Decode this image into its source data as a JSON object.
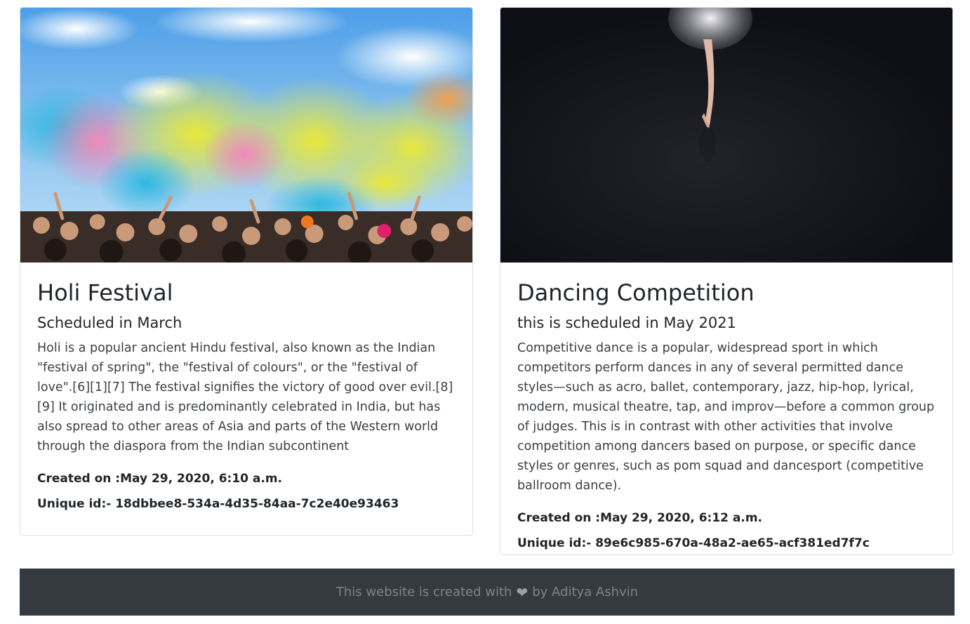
{
  "cards": [
    {
      "image": "holi-festival-colour-powder-crowd-photo",
      "title": "Holi Festival",
      "subtitle": "Scheduled in March",
      "description": "Holi is a popular ancient Hindu festival, also known as the Indian \"festival of spring\", the \"festival of colours\", or the \"festival of love\".[6][1][7] The festival signifies the victory of good over evil.[8][9] It originated and is predominantly celebrated in India, but has also spread to other areas of Asia and parts of the Western world through the diaspora from the Indian subcontinent",
      "created": "Created on :May 29, 2020, 6:10 a.m.",
      "unique_id": "Unique id:- 18dbbee8-534a-4d35-84aa-7c2e40e93463"
    },
    {
      "image": "ballet-dancer-en-pointe-dark-stage-photo",
      "title": "Dancing Competition",
      "subtitle": "this is scheduled in May 2021",
      "description": "Competitive dance is a popular, widespread sport in which competitors perform dances in any of several permitted dance styles—such as acro, ballet, contemporary, jazz, hip-hop, lyrical, modern, musical theatre, tap, and improv—before a common group of judges. This is in contrast with other activities that involve competition among dancers based on purpose, or specific dance styles or genres, such as pom squad and dancesport (competitive ballroom dance).",
      "created": "Created on :May 29, 2020, 6:12 a.m.",
      "unique_id": "Unique id:- 89e6c985-670a-48a2-ae65-acf381ed7f7c"
    }
  ],
  "footer": {
    "text_before": "This website is created with",
    "icon": "heart-icon",
    "text_after": "by Aditya Ashvin"
  },
  "colors": {
    "footer_bg": "#343a40",
    "footer_text": "#7d8388",
    "card_border": "#dcdfe3"
  }
}
